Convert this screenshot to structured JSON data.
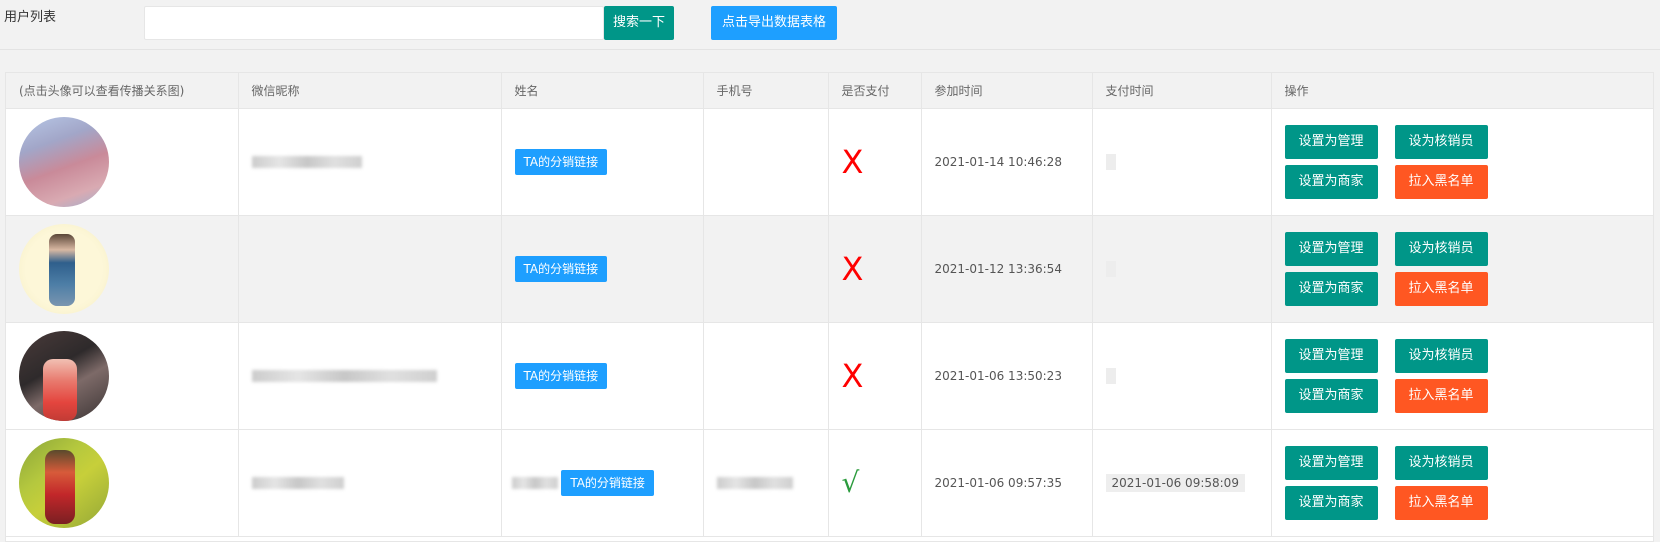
{
  "header": {
    "page_label": "用户列表",
    "search_placeholder": "",
    "search_button": "搜索一下",
    "export_button": "点击导出数据表格"
  },
  "table": {
    "columns": [
      "(点击头像可以查看传播关系图)",
      "微信昵称",
      "姓名",
      "手机号",
      "是否支付",
      "参加时间",
      "支付时间",
      "操作"
    ],
    "rows": [
      {
        "paid": "X",
        "joined": "2021-01-14 10:46:28",
        "pay_time": "",
        "link": "TA的分销链接"
      },
      {
        "paid": "X",
        "joined": "2021-01-12 13:36:54",
        "pay_time": "",
        "link": "TA的分销链接"
      },
      {
        "paid": "X",
        "joined": "2021-01-06 13:50:23",
        "pay_time": "",
        "link": "TA的分销链接"
      },
      {
        "paid": "√",
        "joined": "2021-01-06 09:57:35",
        "pay_time": "2021-01-06 09:58:09",
        "link": "TA的分销链接"
      }
    ],
    "actions": {
      "set_admin": "设置为管理",
      "set_verifier": "设为核销员",
      "set_merchant": "设置为商家",
      "blacklist": "拉入黑名单"
    }
  },
  "colors": {
    "green": "#009688",
    "blue": "#1e9fff",
    "orange": "#ff5722",
    "unpaid_red": "#ff0000",
    "paid_green": "#2b9b3d"
  }
}
